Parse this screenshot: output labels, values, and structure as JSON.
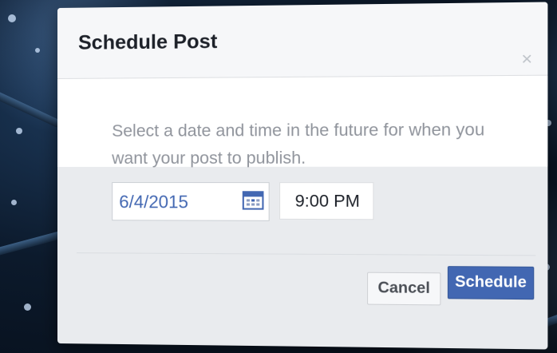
{
  "dialog": {
    "title": "Schedule Post",
    "close_glyph": "×",
    "instructions": "Select a date and time in the future for when you want your post to publish.",
    "date_value": "6/4/2015",
    "time_value": "9:00 PM",
    "cancel_label": "Cancel",
    "schedule_label": "Schedule"
  },
  "icons": {
    "close": "close-icon",
    "calendar": "calendar-icon"
  },
  "colors": {
    "accent": "#4267b2",
    "date_text": "#4267b2",
    "muted_text": "#90949c"
  }
}
